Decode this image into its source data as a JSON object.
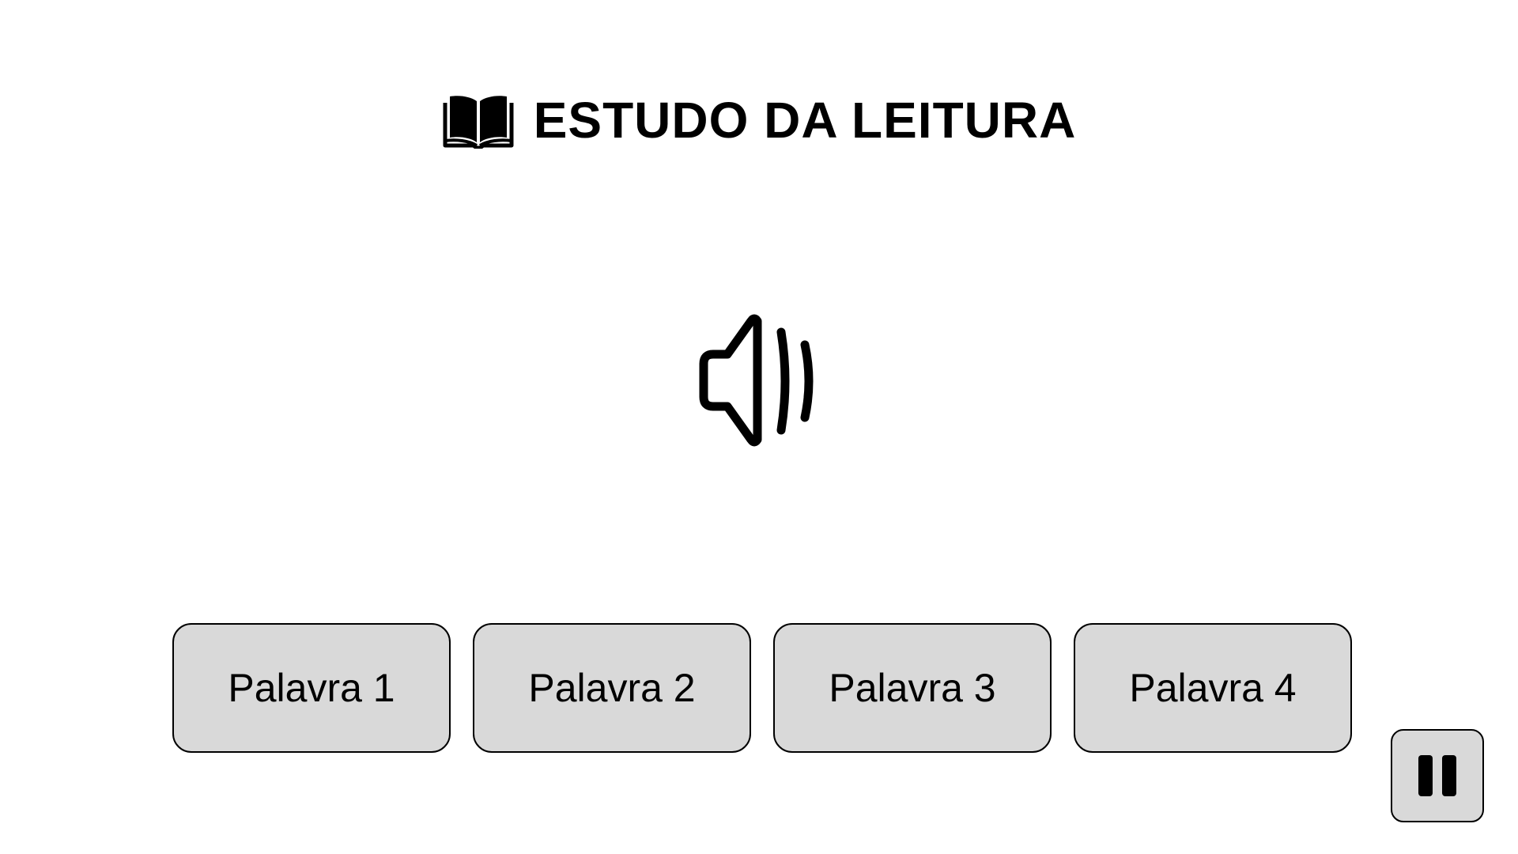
{
  "header": {
    "icon": "open-book-icon",
    "title": "ESTUDO DA LEITURA"
  },
  "audio": {
    "icon": "speaker-sound-icon"
  },
  "options": [
    {
      "label": "Palavra 1"
    },
    {
      "label": "Palavra 2"
    },
    {
      "label": "Palavra 3"
    },
    {
      "label": "Palavra 4"
    }
  ],
  "controls": {
    "pause_icon": "pause-icon"
  },
  "colors": {
    "background": "#ffffff",
    "button_fill": "#d9d9d9",
    "border": "#000000",
    "text": "#000000"
  }
}
